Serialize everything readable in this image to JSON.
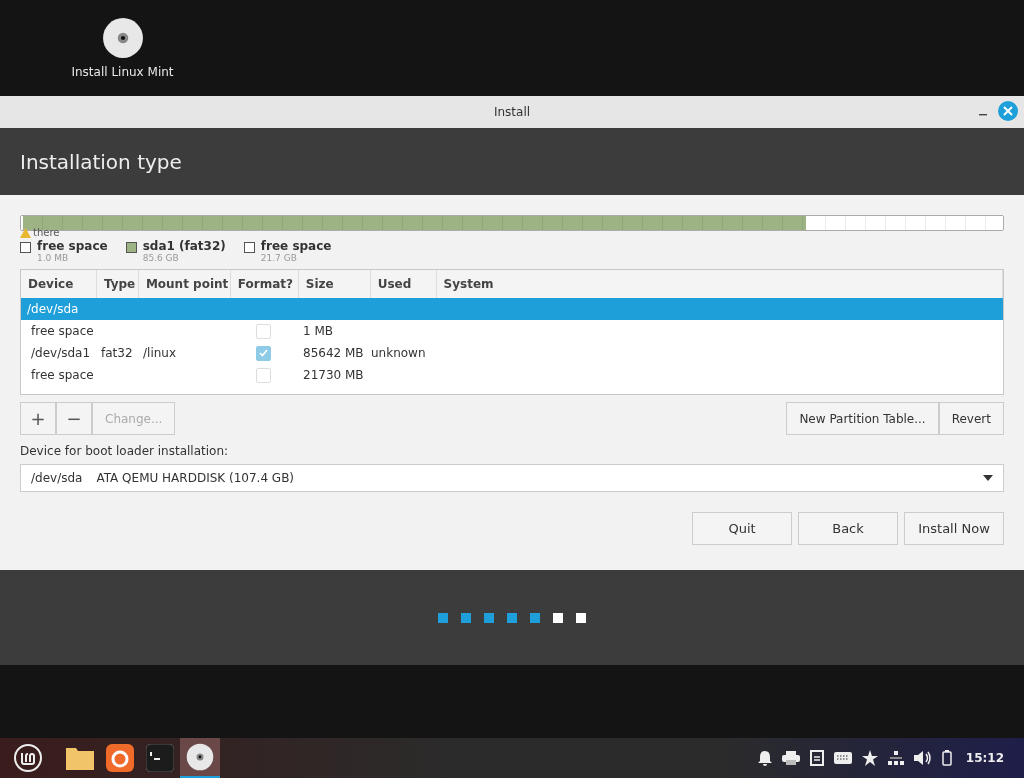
{
  "desktop_icon": {
    "label": "Install Linux Mint"
  },
  "window": {
    "title": "Install",
    "heading": "Installation type"
  },
  "partition_bar": {
    "warning": "there",
    "segments": [
      {
        "level": 0.002,
        "color": "#ffffff"
      },
      {
        "level": 0.797,
        "color": "#9db384"
      },
      {
        "level": 0.201,
        "color": "#ffffff"
      }
    ]
  },
  "legend": [
    {
      "name": "free space",
      "size": "1.0 MB",
      "color": "#ffffff"
    },
    {
      "name": "sda1 (fat32)",
      "size": "85.6 GB",
      "color": "#9db384"
    },
    {
      "name": "free space",
      "size": "21.7 GB",
      "color": "#ffffff"
    }
  ],
  "table": {
    "columns": [
      "Device",
      "Type",
      "Mount point",
      "Format?",
      "Size",
      "Used",
      "System"
    ],
    "rows": [
      {
        "kind": "disk",
        "device": "/dev/sda",
        "selected": true
      },
      {
        "kind": "partition",
        "device": "free space",
        "type": "",
        "mount": "",
        "format": false,
        "size": "1 MB",
        "used": "",
        "selected": false
      },
      {
        "kind": "partition",
        "device": "/dev/sda1",
        "type": "fat32",
        "mount": "/linux",
        "format": true,
        "size": "85642 MB",
        "used": "unknown",
        "selected": false
      },
      {
        "kind": "partition",
        "device": "free space",
        "type": "",
        "mount": "",
        "format": false,
        "size": "21730 MB",
        "used": "",
        "selected": false
      }
    ]
  },
  "toolbar": {
    "add": "+",
    "remove": "−",
    "change": "Change...",
    "change_disabled": true,
    "new_table": "New Partition Table...",
    "revert": "Revert"
  },
  "bootloader": {
    "label": "Device for boot loader installation:",
    "device": "/dev/sda",
    "description": "ATA QEMU HARDDISK (107.4 GB)"
  },
  "buttons": [
    "Quit",
    "Back",
    "Install Now"
  ],
  "progress": [
    {
      "done": true
    },
    {
      "done": true
    },
    {
      "done": true
    },
    {
      "done": true
    },
    {
      "done": true
    },
    {
      "done": false
    },
    {
      "done": false
    }
  ],
  "taskbar": {
    "clock": "15:12"
  }
}
